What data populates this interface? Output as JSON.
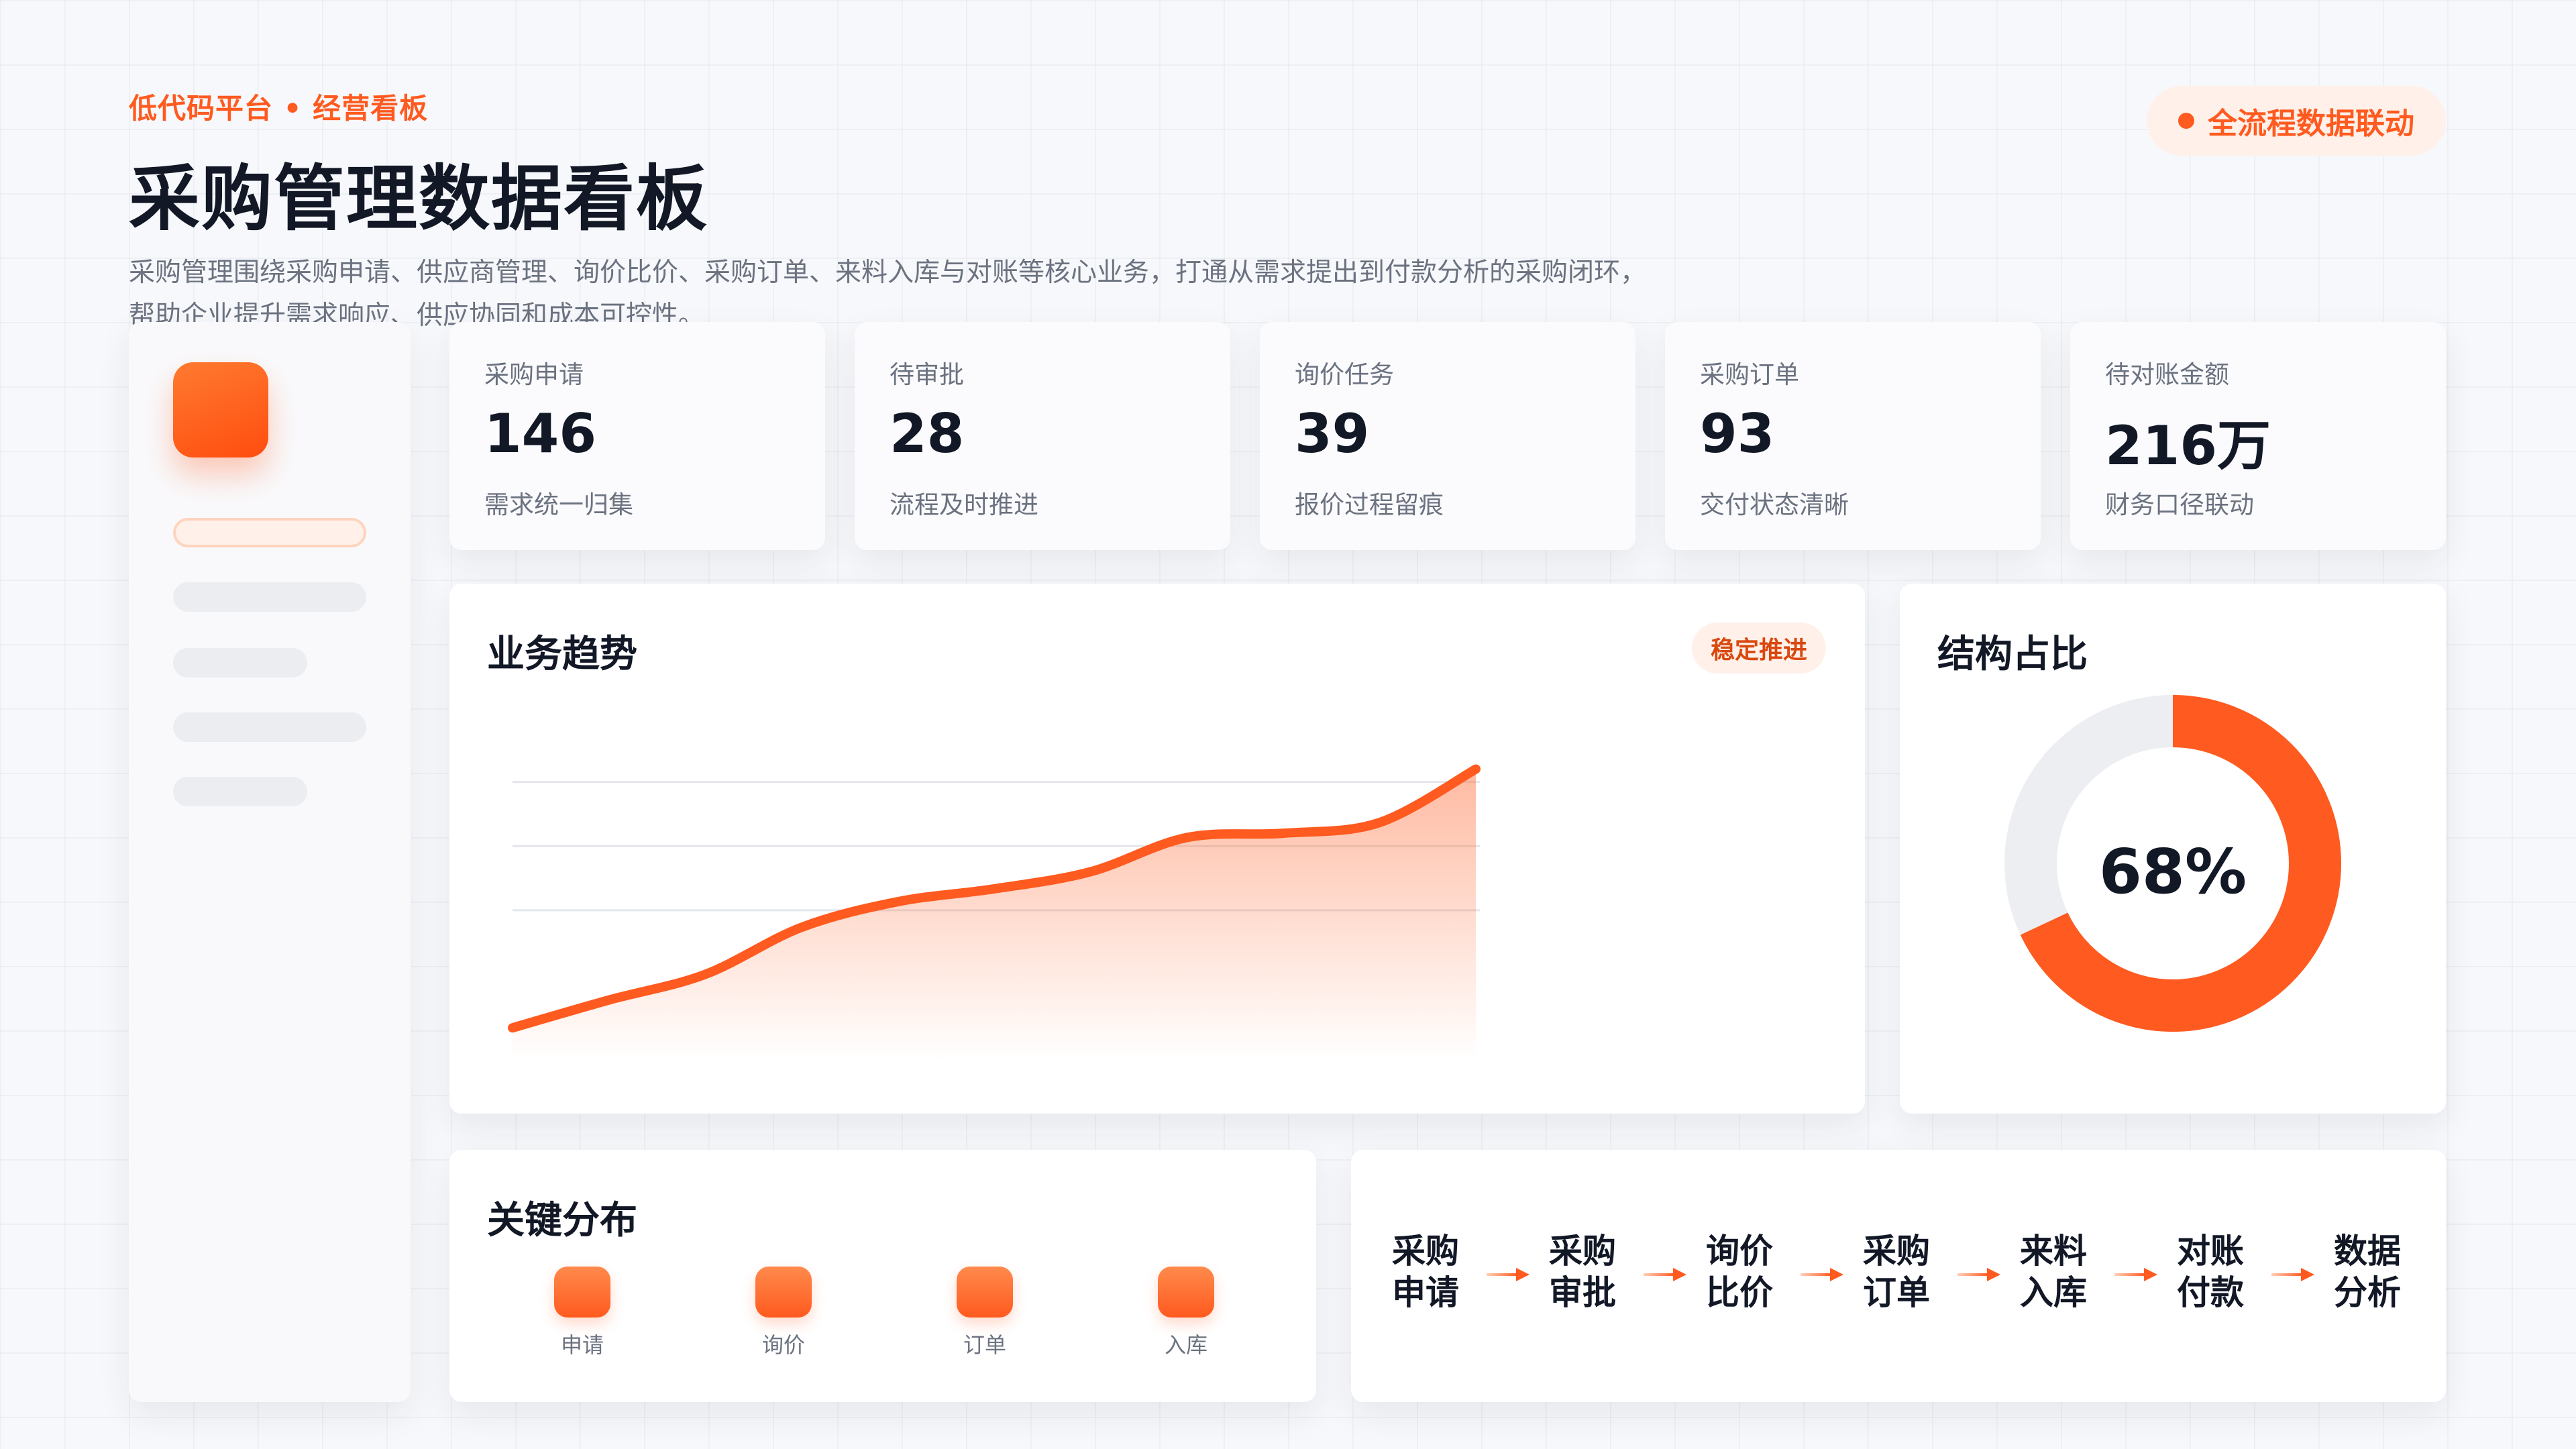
{
  "header": {
    "eyebrow": "低代码平台 • 经营看板",
    "title": "采购管理数据看板",
    "description": "采购管理围绕采购申请、供应商管理、询价比价、采购订单、来料入库与对账等核心业务，打通从需求提出到付款分析的采购闭环，帮助企业提升需求响应、供应协同和成本可控性。",
    "badge": "全流程数据联动"
  },
  "kpis": [
    {
      "label": "采购申请",
      "value": "146",
      "sub": "需求统一归集"
    },
    {
      "label": "待审批",
      "value": "28",
      "sub": "流程及时推进"
    },
    {
      "label": "询价任务",
      "value": "39",
      "sub": "报价过程留痕"
    },
    {
      "label": "采购订单",
      "value": "93",
      "sub": "交付状态清晰"
    },
    {
      "label": "待对账金额",
      "value": "216万",
      "sub": "财务口径联动"
    }
  ],
  "trend": {
    "title": "业务趋势",
    "tag": "稳定推进"
  },
  "structure": {
    "title": "结构占比",
    "percent_label": "68%"
  },
  "distribution": {
    "title": "关键分布",
    "items": [
      "申请",
      "询价",
      "订单",
      "入库"
    ]
  },
  "flow": {
    "steps": [
      "采购申请",
      "采购审批",
      "询价比价",
      "采购订单",
      "来料入库",
      "对账付款",
      "数据分析"
    ]
  },
  "colors": {
    "accent": "#ff5a1f",
    "accent_soft": "#fff1ea",
    "track": "#eceef2"
  },
  "chart_data": [
    {
      "type": "area",
      "title": "业务趋势",
      "x": [
        0,
        1,
        2,
        3,
        4,
        5,
        6,
        7,
        8,
        9,
        10
      ],
      "values": [
        15,
        28,
        40,
        62,
        74,
        80,
        88,
        104,
        106,
        111,
        136
      ],
      "ylim": [
        0,
        160
      ],
      "grid": true
    },
    {
      "type": "pie",
      "title": "结构占比",
      "categories": [
        "",
        ""
      ],
      "values": [
        68,
        32
      ],
      "center_label": "68%"
    }
  ]
}
